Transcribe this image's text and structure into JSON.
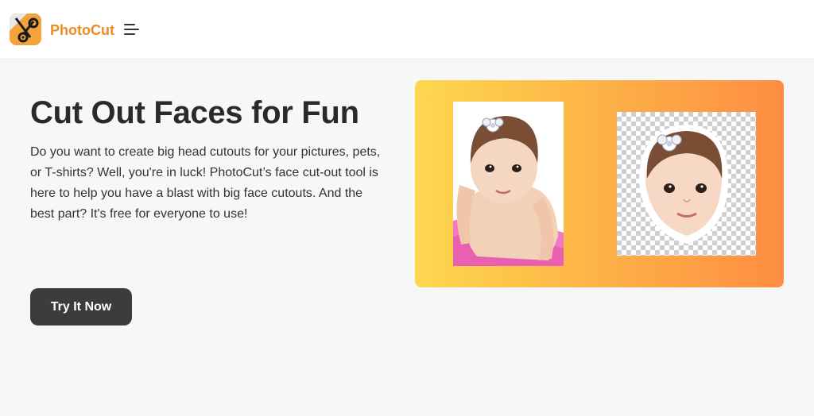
{
  "header": {
    "brand": "PhotoCut",
    "logo_icon": "scissors-icon",
    "menu_icon": "hamburger-menu-icon"
  },
  "hero": {
    "title": "Cut Out Faces for Fun",
    "description": "Do you want to create big head cutouts for your pictures, pets, or T-shirts? Well, you're in luck! PhotoCut’s face cut-out tool is here to help you have a blast with big face cutouts. And the best part? It's free for everyone to use!",
    "cta_label": "Try It Now"
  },
  "colors": {
    "brand_orange": "#f08a24",
    "cta_bg": "#3d3b3b",
    "gradient_start": "#fdd84e",
    "gradient_end": "#fe8d43"
  },
  "illustration": {
    "before_image": "baby-original-photo",
    "after_image": "baby-face-cutout-transparent"
  }
}
